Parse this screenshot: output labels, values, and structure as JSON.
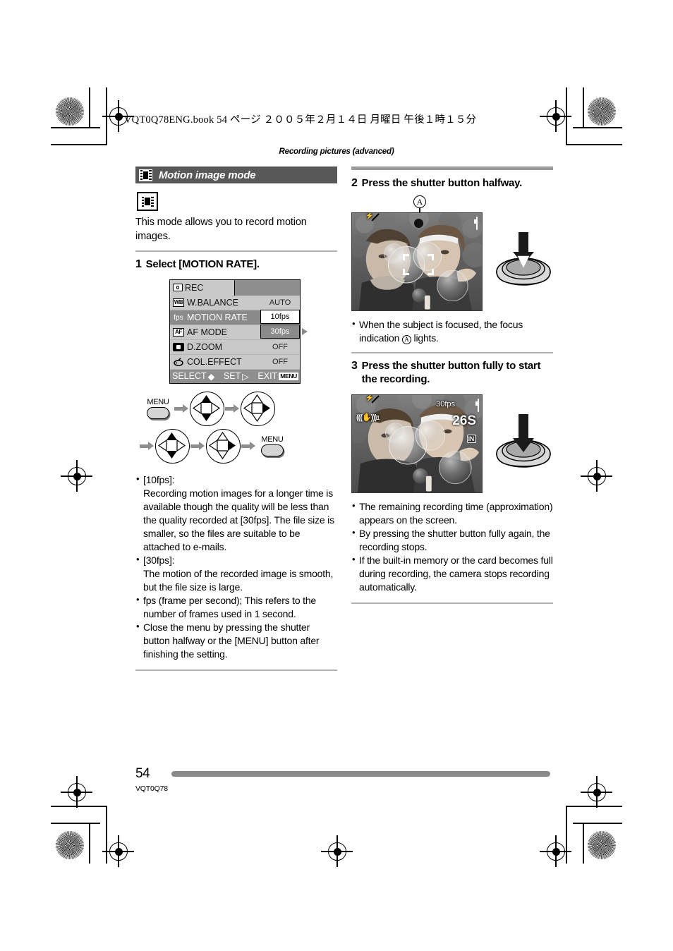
{
  "page": {
    "file_info": "VQT0Q78ENG.book   54 ページ   ２００５年２月１４日   月曜日   午後１時１５分",
    "running_head": "Recording pictures (advanced)",
    "page_number": "54",
    "doc_code": "VQT0Q78"
  },
  "left_column": {
    "section_title": "Motion image mode",
    "section_icon": "film-strip-icon",
    "mode_icon": "motion-image-mode-icon",
    "intro": "This mode allows you to record motion images.",
    "step1": {
      "number": "1",
      "text": "Select [MOTION RATE]."
    },
    "lcd_menu": {
      "tab_label": "REC",
      "tab_icon": "camera-icon",
      "rows": [
        {
          "icon": "wb-icon",
          "icon_text": "WB",
          "label": "W.BALANCE",
          "value": "AUTO"
        },
        {
          "icon": "fps-icon",
          "icon_text": "fps",
          "label": "MOTION RATE",
          "value": ""
        },
        {
          "icon": "af-icon",
          "icon_text": "AF",
          "label": "AF MODE",
          "value": ""
        },
        {
          "icon": "dzoom-icon",
          "icon_text": "",
          "label": "D.ZOOM",
          "value": "OFF"
        },
        {
          "icon": "coleffect-icon",
          "icon_text": "",
          "label": "COL.EFFECT",
          "value": "OFF"
        }
      ],
      "popup_option_1": "10fps",
      "popup_option_2": "30fps",
      "footer": {
        "select": "SELECT",
        "set": "SET",
        "exit": "EXIT",
        "menu_chip": "MENU"
      }
    },
    "button_diagram": {
      "menu_label_1": "MENU",
      "menu_label_2": "MENU",
      "sequence": [
        "menu-button",
        "arrow-right",
        "dpad-up-down",
        "arrow-right",
        "dpad-right",
        "arrow-right",
        "dpad-up-down",
        "arrow-right",
        "dpad-right",
        "arrow-right",
        "menu-button"
      ]
    },
    "notes": [
      {
        "lead": "[10fps]:",
        "body": "Recording motion images for a longer time is available though the quality will be less than the quality recorded at [30fps]. The file size is smaller, so the files are suitable to be attached to e-mails."
      },
      {
        "lead": "[30fps]:",
        "body": "The motion of the recorded image is smooth, but the file size is large."
      },
      {
        "lead": "",
        "body": "fps (frame per second);  This refers to the number of frames used in 1 second."
      },
      {
        "lead": "",
        "body": "Close the menu by pressing the shutter button halfway or the [MENU] button after finishing the setting."
      }
    ]
  },
  "right_column": {
    "step2": {
      "number": "2",
      "text": "Press the shutter button halfway."
    },
    "photo2": {
      "callout_label": "A",
      "osd": {
        "mode_icon": "motion-image-icon",
        "flash_icon": "flash-off-icon",
        "battery_icon": "battery-icon"
      },
      "af_frame": "af-frame-brackets",
      "focus_indicator": "focus-indication-dot"
    },
    "shutter_fig_2": "shutter-button-halfway-press",
    "note2_parts": {
      "before": "When the subject is focused, the focus indication ",
      "marker": "A",
      "after": " lights."
    },
    "step3": {
      "number": "3",
      "text": "Press the shutter button fully to start the recording."
    },
    "photo3": {
      "osd": {
        "mode_icon": "motion-image-icon",
        "flash_icon": "flash-off-icon",
        "stabilizer_icon": "image-stabilizer-icon",
        "stabilizer_mode": "1",
        "motion_rate": "30fps",
        "battery_icon": "battery-icon",
        "remaining_time": "26S",
        "memory_icon": "IN"
      }
    },
    "shutter_fig_3": "shutter-button-full-press",
    "notes": [
      "The remaining recording time (approximation) appears on the screen.",
      "By pressing the shutter button fully again, the recording stops.",
      "If the built-in memory or the card becomes full during recording, the camera stops recording automatically."
    ]
  }
}
